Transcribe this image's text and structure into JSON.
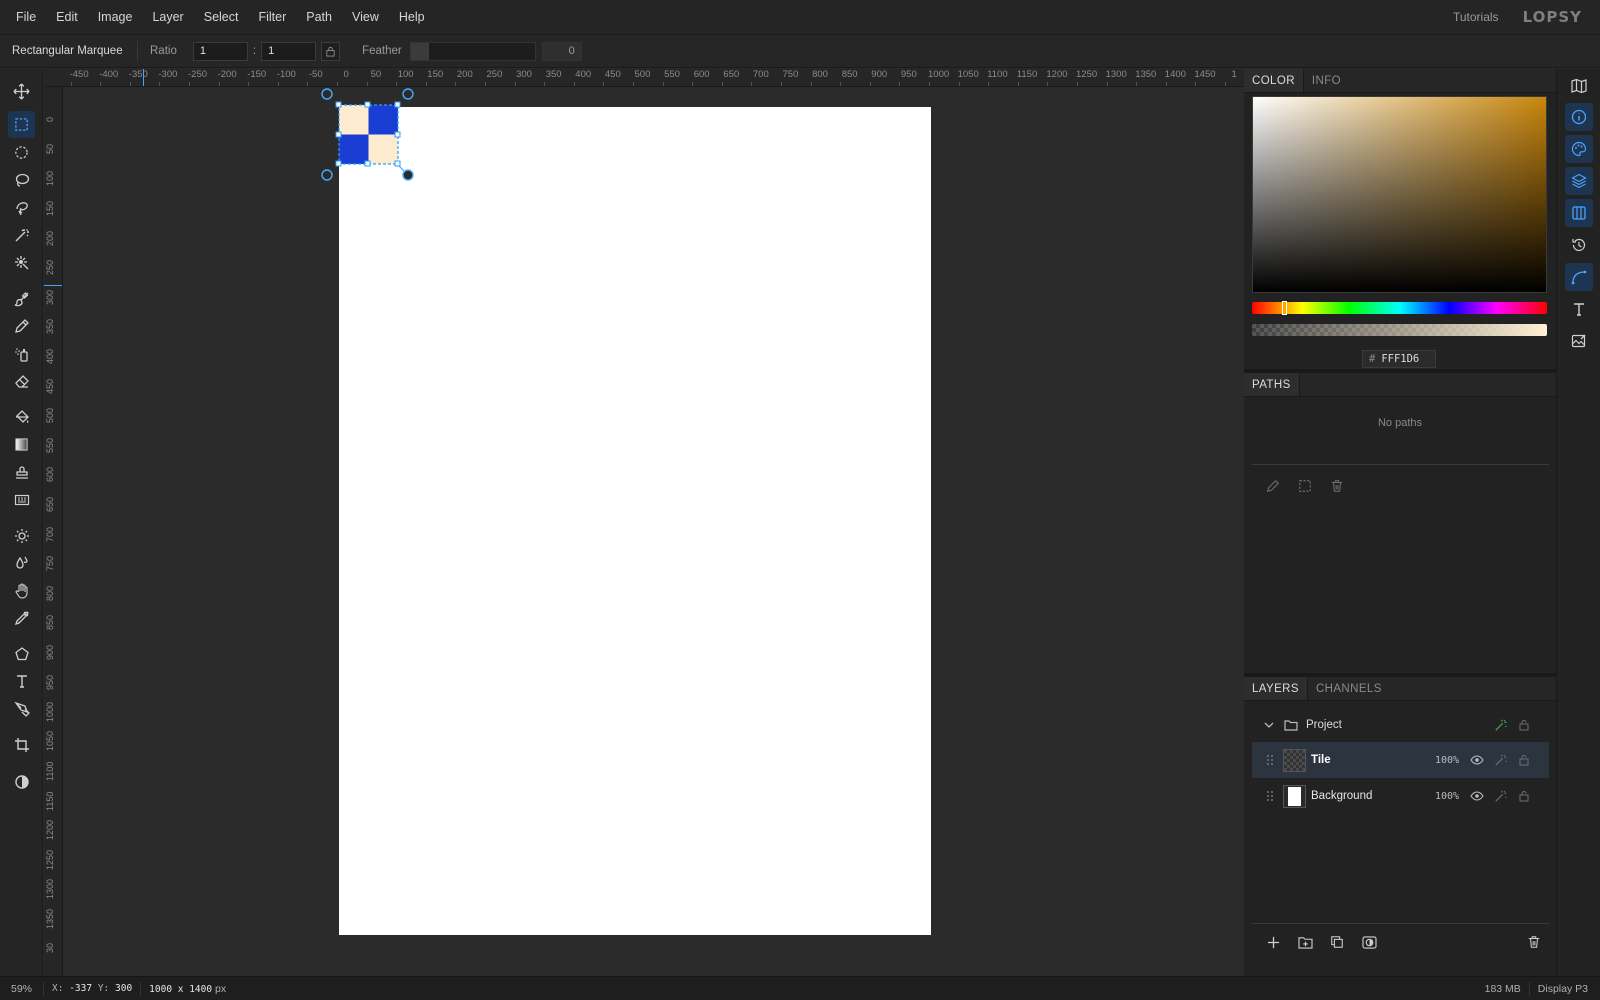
{
  "menubar": {
    "items": [
      "File",
      "Edit",
      "Image",
      "Layer",
      "Select",
      "Filter",
      "Path",
      "View",
      "Help"
    ],
    "tutorials": "Tutorials",
    "logo": "LOPSY"
  },
  "options": {
    "tool_name": "Rectangular Marquee",
    "ratio_label": "Ratio",
    "ratio_w": "1",
    "ratio_colon": ":",
    "ratio_h": "1",
    "feather_label": "Feather",
    "feather_value": "0"
  },
  "rulers": {
    "top": [
      "-450",
      "-400",
      "-350",
      "-300",
      "-250",
      "-200",
      "-150",
      "-100",
      "-50",
      "0",
      "50",
      "100",
      "150",
      "200",
      "250",
      "300",
      "350",
      "400",
      "450",
      "500",
      "550",
      "600",
      "650",
      "700",
      "750",
      "800",
      "850",
      "900",
      "950",
      "1000",
      "1050",
      "1100",
      "1150",
      "1200",
      "1250",
      "1300",
      "1350",
      "1400",
      "1450",
      "1"
    ],
    "left": [
      "0",
      "50",
      "100",
      "150",
      "200",
      "250",
      "300",
      "350",
      "400",
      "450",
      "500",
      "550",
      "600",
      "650",
      "700",
      "750",
      "800",
      "850",
      "900",
      "950",
      "1000",
      "1050",
      "1100",
      "1150",
      "1200",
      "1250",
      "1300",
      "1350",
      "30"
    ]
  },
  "tile": {
    "cream": "#fdebcf",
    "blue": "#1a3ed4"
  },
  "color_panel": {
    "tabs": [
      "COLOR",
      "INFO"
    ],
    "hex_hash": "#",
    "hex_value": "FFF1D6"
  },
  "paths_panel": {
    "title": "PATHS",
    "empty": "No paths"
  },
  "layers_panel": {
    "tabs": [
      "LAYERS",
      "CHANNELS"
    ],
    "group": "Project",
    "layers": [
      {
        "name": "Tile",
        "opacity": "100%"
      },
      {
        "name": "Background",
        "opacity": "100%"
      }
    ]
  },
  "status": {
    "zoom": "59%",
    "coords_x_label": "X:",
    "coords_x": "-337",
    "coords_y_label": "Y:",
    "coords_y": "300",
    "doc_size": "1000 x 1400",
    "doc_unit": "px",
    "memory": "183 MB",
    "profile": "Display P3"
  }
}
